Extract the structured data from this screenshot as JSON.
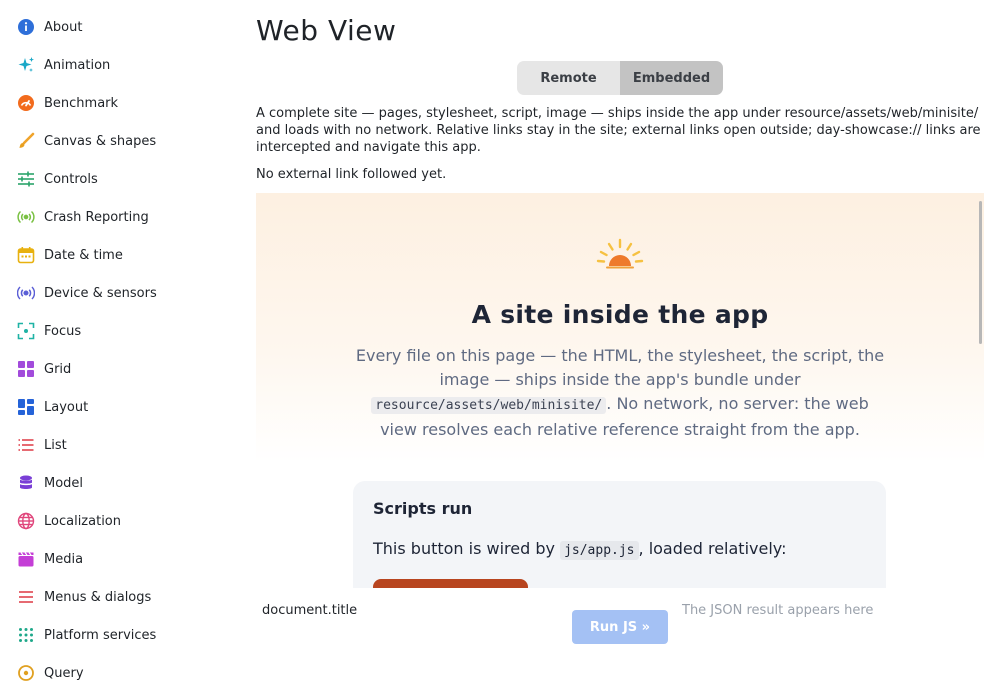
{
  "sidebar": {
    "items": [
      {
        "label": "About",
        "icon": "info-icon",
        "color": "#2e6fd9"
      },
      {
        "label": "Animation",
        "icon": "sparkles-icon",
        "color": "#1aa8c7"
      },
      {
        "label": "Benchmark",
        "icon": "speedometer-icon",
        "color": "#f26b1d"
      },
      {
        "label": "Canvas & shapes",
        "icon": "brush-icon",
        "color": "#f0a32a"
      },
      {
        "label": "Controls",
        "icon": "sliders-icon",
        "color": "#2aa36b"
      },
      {
        "label": "Crash Reporting",
        "icon": "broadcast-icon",
        "color": "#7ac143"
      },
      {
        "label": "Date & time",
        "icon": "calendar-icon",
        "color": "#e8b10f"
      },
      {
        "label": "Device & sensors",
        "icon": "sensor-icon",
        "color": "#5b5fd6"
      },
      {
        "label": "Focus",
        "icon": "focus-icon",
        "color": "#1fb3a5"
      },
      {
        "label": "Grid",
        "icon": "grid-icon",
        "color": "#a24bdb"
      },
      {
        "label": "Layout",
        "icon": "layout-icon",
        "color": "#2563d8"
      },
      {
        "label": "List",
        "icon": "list-icon",
        "color": "#e0454f"
      },
      {
        "label": "Model",
        "icon": "database-icon",
        "color": "#7a3fd6"
      },
      {
        "label": "Localization",
        "icon": "globe-icon",
        "color": "#e0457b"
      },
      {
        "label": "Media",
        "icon": "clapperboard-icon",
        "color": "#c43ed6"
      },
      {
        "label": "Menus & dialogs",
        "icon": "menu-icon",
        "color": "#e0454f"
      },
      {
        "label": "Platform services",
        "icon": "dots-grid-icon",
        "color": "#1fa88a"
      },
      {
        "label": "Query",
        "icon": "query-icon",
        "color": "#e0a020"
      }
    ]
  },
  "header": {
    "title": "Web View"
  },
  "segmented": {
    "remote_label": "Remote",
    "embedded_label": "Embedded",
    "selected": "Embedded"
  },
  "description": "A complete site — pages, stylesheet, script, image — ships inside the app under resource/assets/web/minisite/ and loads with no network. Relative links stay in the site; external links open outside; day-showcase:// links are intercepted and navigate this app.",
  "link_status": "No external link followed yet.",
  "webview": {
    "hero_title": "A site inside the app",
    "hero_text_before": "Every file on this page — the HTML, the stylesheet, the script, the image — ships inside the app's bundle under ",
    "hero_code": "resource/assets/web/minisite/",
    "hero_text_after": ". No network, no server: the web view resolves each relative reference straight from the app.",
    "card": {
      "title": "Scripts run",
      "text_before": "This button is wired by ",
      "code": "js/app.js",
      "text_after": ", loaded relatively:"
    }
  },
  "js_bar": {
    "input_value": "document.title",
    "run_label": "Run JS »",
    "result_placeholder": "The JSON result appears here"
  }
}
